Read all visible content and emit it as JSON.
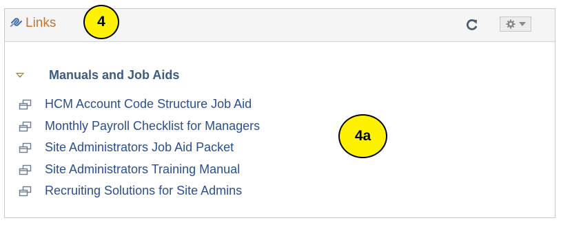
{
  "header": {
    "title": "Links",
    "icons": {
      "links": "links-chain-icon",
      "refresh": "refresh-icon",
      "settings": "gear-icon",
      "settings_menu": "caret-down-icon"
    }
  },
  "annotations": {
    "callout_main": "4",
    "callout_links": "4a"
  },
  "group": {
    "title": "Manuals and Job Aids",
    "toggle_icon": "collapse-triangle-icon"
  },
  "links": [
    {
      "label": "HCM Account Code Structure Job Aid",
      "icon": "new-window-icon"
    },
    {
      "label": "Monthly Payroll Checklist for Managers",
      "icon": "new-window-icon"
    },
    {
      "label": "Site Administrators Job Aid Packet",
      "icon": "new-window-icon"
    },
    {
      "label": "Site Administrators Training Manual",
      "icon": "new-window-icon"
    },
    {
      "label": "Recruiting Solutions for Site Admins",
      "icon": "new-window-icon"
    }
  ],
  "colors": {
    "header_title": "#c8742e",
    "link_text": "#2b4f8f",
    "group_title": "#3d5a80",
    "callout_fill": "#fff200"
  }
}
